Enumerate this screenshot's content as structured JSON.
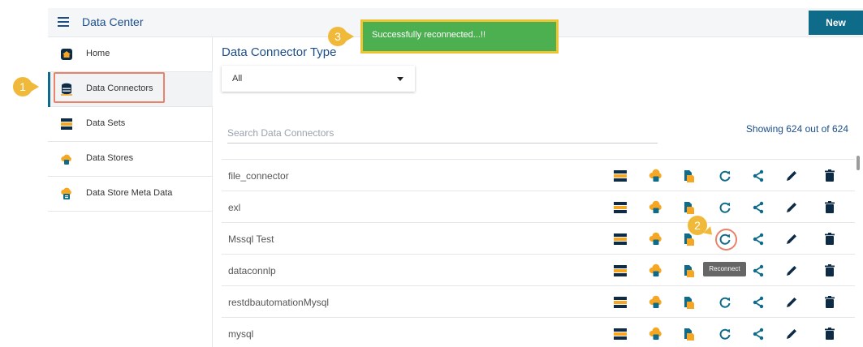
{
  "header": {
    "title": "Data Center",
    "new_label": "New"
  },
  "toast": {
    "message": "Successfully reconnected...!!"
  },
  "sidebar": {
    "items": [
      {
        "label": "Home",
        "icon": "home-icon"
      },
      {
        "label": "Data Connectors",
        "icon": "database-icon"
      },
      {
        "label": "Data Sets",
        "icon": "dataset-icon"
      },
      {
        "label": "Data Stores",
        "icon": "cloud-icon"
      },
      {
        "label": "Data Store Meta Data",
        "icon": "meta-cloud-icon"
      }
    ]
  },
  "main": {
    "title": "Data Connector Type",
    "type_value": "All",
    "search_placeholder": "Search Data Connectors",
    "showing": "Showing 624 out of 624",
    "connectors": [
      "file_connector",
      "exl",
      "Mssql Test",
      "dataconnlp",
      "restdbautomationMysql",
      "mysql"
    ],
    "tooltip": "Reconnect"
  },
  "annotations": {
    "step1": "1",
    "step2": "2",
    "step3": "3"
  },
  "colors": {
    "accent": "#0e6b8a",
    "title_blue": "#1b4d8a",
    "toast_green": "#4caf50",
    "badge_yellow": "#f0b93a",
    "highlight_orange": "#e8826a",
    "icon_orange": "#f5a623",
    "icon_teal": "#0e6b8a",
    "icon_dark": "#0d2b45"
  }
}
